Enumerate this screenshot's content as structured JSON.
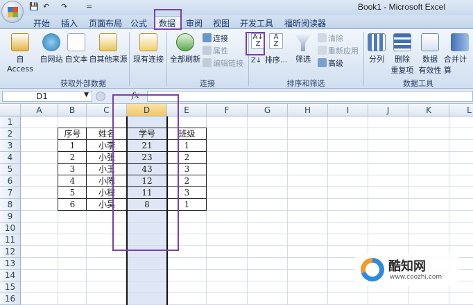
{
  "window": {
    "title": "Book1 - Microsoft Excel"
  },
  "qat": {
    "save": "💾",
    "undo": "↶",
    "redo": "↷",
    "customize": "="
  },
  "tabs": [
    "开始",
    "插入",
    "页面布局",
    "公式",
    "数据",
    "审阅",
    "视图",
    "开发工具",
    "福昕阅读器"
  ],
  "ribbon": {
    "external_data": {
      "label": "获取外部数据",
      "from_access": "自 Access",
      "from_web": "自网站",
      "from_text": "自文本",
      "from_other": "自其他来源",
      "existing": "现有连接"
    },
    "connections": {
      "label": "连接",
      "refresh_all": "全部刷新",
      "connections": "连接",
      "properties": "属性",
      "edit_links": "编辑链接"
    },
    "sort_filter": {
      "label": "排序和筛选",
      "sort": "排序...",
      "filter": "筛选",
      "clear": "清除",
      "reapply": "重新应用",
      "advanced": "高级"
    },
    "data_tools": {
      "label": "数据工具",
      "split": "分列",
      "remove_dup_1": "删除",
      "remove_dup_2": "重复项",
      "validation_1": "数据",
      "validation_2": "有效性",
      "consolidate": "合并计算"
    }
  },
  "formula_bar": {
    "name_box": "D1",
    "fx": "fx",
    "value": ""
  },
  "columns": [
    "A",
    "B",
    "C",
    "D",
    "E",
    "F",
    "G",
    "H",
    "I",
    "J",
    "K",
    "L"
  ],
  "rows": [
    "1",
    "2",
    "3",
    "4",
    "5",
    "6",
    "7",
    "8",
    "9",
    "10",
    "11",
    "12",
    "13",
    "14",
    "15",
    "16"
  ],
  "table": {
    "headers": [
      "序号",
      "姓名",
      "学号",
      "班级"
    ],
    "rows": [
      [
        "1",
        "小李",
        "21",
        "1"
      ],
      [
        "2",
        "小张",
        "23",
        "2"
      ],
      [
        "3",
        "小王",
        "43",
        "3"
      ],
      [
        "4",
        "小陈",
        "12",
        "2"
      ],
      [
        "5",
        "小程",
        "11",
        "3"
      ],
      [
        "6",
        "小吴",
        "8",
        "1"
      ]
    ]
  },
  "watermark": {
    "brand": "酷知网",
    "url": "www.coozhi.com"
  },
  "colors": {
    "highlight": "#7b3fa9",
    "selection": "#dfe6f5",
    "header_active": "#f9d98a"
  }
}
